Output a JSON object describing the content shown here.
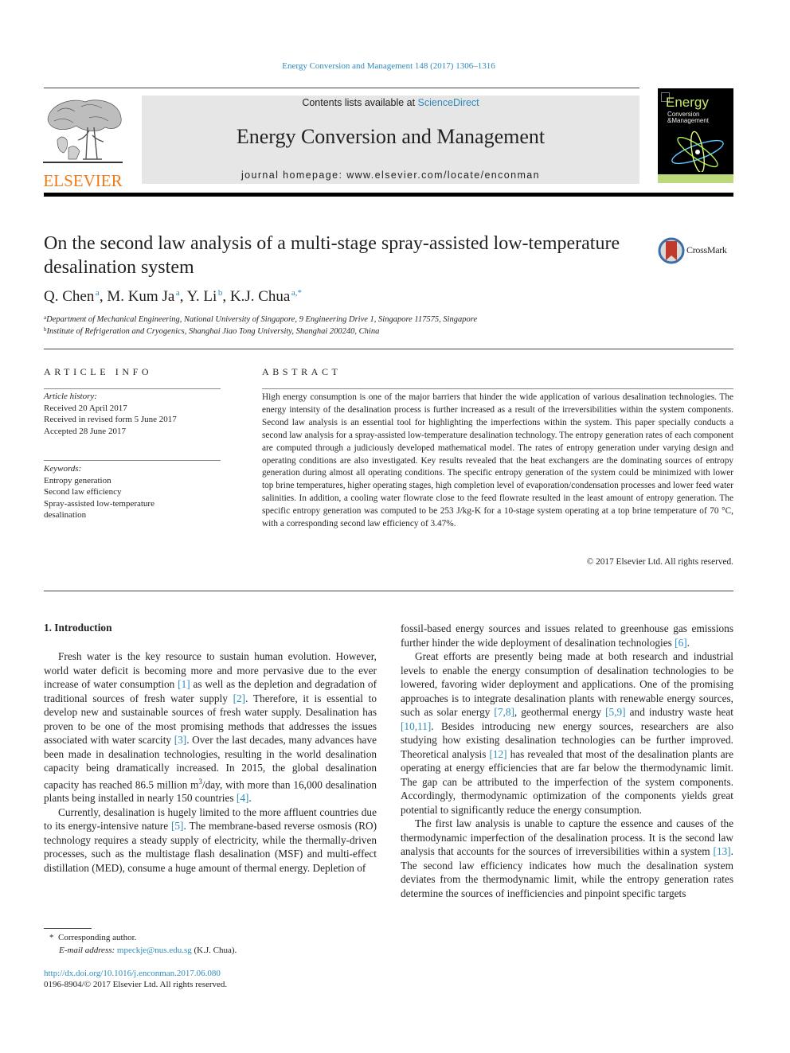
{
  "header": {
    "journal_reference": "Energy Conversion and Management 148 (2017) 1306–1316",
    "contents_prefix": "Contents lists available at ",
    "contents_link": "ScienceDirect",
    "journal_name": "Energy Conversion and Management",
    "homepage_line": "journal homepage: www.elsevier.com/locate/enconman",
    "publisher_logo_text": "ELSEVIER",
    "cover": {
      "title": "Energy",
      "subtitle_1": "Conversion",
      "subtitle_2": "&Management"
    },
    "colors": {
      "link": "#2c8bbb",
      "elsevier_orange": "#ee7b1a",
      "masthead_gray": "#e6e6e6"
    }
  },
  "article": {
    "title": "On the second law analysis of a multi-stage spray-assisted low-temperature desalination system",
    "crossmark_label": "CrossMark",
    "authors": [
      {
        "name": "Q. Chen",
        "sup": "a"
      },
      {
        "name": "M. Kum Ja",
        "sup": "a"
      },
      {
        "name": "Y. Li",
        "sup": "b"
      },
      {
        "name": "K.J. Chua",
        "sup": "a,*"
      }
    ],
    "affiliations": [
      {
        "label": "a",
        "text": "Department of Mechanical Engineering, National University of Singapore, 9 Engineering Drive 1, Singapore 117575, Singapore"
      },
      {
        "label": "b",
        "text": "Institute of Refrigeration and Cryogenics, Shanghai Jiao Tong University, Shanghai 200240, China"
      }
    ]
  },
  "article_info": {
    "heading": "ARTICLE INFO",
    "history_label": "Article history:",
    "history": [
      "Received 20 April 2017",
      "Received in revised form 5 June 2017",
      "Accepted 28 June 2017"
    ],
    "keywords_label": "Keywords:",
    "keywords": [
      "Entropy generation",
      "Second law efficiency",
      "Spray-assisted low-temperature",
      "desalination"
    ]
  },
  "abstract": {
    "heading": "ABSTRACT",
    "text": "High energy consumption is one of the major barriers that hinder the wide application of various desalination technologies. The energy intensity of the desalination process is further increased as a result of the irreversibilities within the system components. Second law analysis is an essential tool for highlighting the imperfections within the system. This paper specially conducts a second law analysis for a spray-assisted low-temperature desalination technology. The entropy generation rates of each component are computed through a judiciously developed mathematical model. The rates of entropy generation under varying design and operating conditions are also investigated. Key results revealed that the heat exchangers are the dominating sources of entropy generation during almost all operating conditions. The specific entropy generation of the system could be minimized with lower top brine temperatures, higher operating stages, high completion level of evaporation/condensation processes and lower feed water salinities. In addition, a cooling water flowrate close to the feed flowrate resulted in the least amount of entropy generation. The specific entropy generation was computed to be 253 J/kg-K for a 10-stage system operating at a top brine temperature of 70 °C, with a corresponding second law efficiency of 3.47%.",
    "copyright": "© 2017 Elsevier Ltd. All rights reserved."
  },
  "body": {
    "section_heading": "1. Introduction",
    "left_column": {
      "p1": [
        {
          "t": "Fresh water is the key resource to sustain human evolution. However, world water deficit is becoming more and more pervasive due to the ever increase of water consumption "
        },
        {
          "ref": "[1]"
        },
        {
          "t": " as well as the depletion and degradation of traditional sources of fresh water supply "
        },
        {
          "ref": "[2]"
        },
        {
          "t": ". Therefore, it is essential to develop new and sustainable sources of fresh water supply. Desalination has proven to be one of the most promising methods that addresses the issues associated with water scarcity "
        },
        {
          "ref": "[3]"
        },
        {
          "t": ". Over the last decades, many advances have been made in desalination technologies, resulting in the world desalination capacity being dramatically increased. In 2015, the global desalination capacity has reached 86.5 million m"
        },
        {
          "sup": "3"
        },
        {
          "t": "/day, with more than 16,000 desalination plants being installed in nearly 150 countries "
        },
        {
          "ref": "[4]"
        },
        {
          "t": "."
        }
      ],
      "p2": [
        {
          "t": "Currently, desalination is hugely limited to the more affluent countries due to its energy-intensive nature "
        },
        {
          "ref": "[5]"
        },
        {
          "t": ". The membrane-based reverse osmosis (RO) technology requires a steady supply of electricity, while the thermally-driven processes, such as the multistage flash desalination (MSF) and multi-effect distillation (MED), consume a huge amount of thermal energy. Depletion of"
        }
      ]
    },
    "right_column": {
      "p0": [
        {
          "t": "fossil-based energy sources and issues related to greenhouse gas emissions further hinder the wide deployment of desalination technologies "
        },
        {
          "ref": "[6]"
        },
        {
          "t": "."
        }
      ],
      "p1": [
        {
          "t": "Great efforts are presently being made at both research and industrial levels to enable the energy consumption of desalination technologies to be lowered, favoring wider deployment and applications. One of the promising approaches is to integrate desalination plants with renewable energy sources, such as solar energy "
        },
        {
          "ref": "[7,8]"
        },
        {
          "t": ", geothermal energy "
        },
        {
          "ref": "[5,9]"
        },
        {
          "t": " and industry waste heat "
        },
        {
          "ref": "[10,11]"
        },
        {
          "t": ". Besides introducing new energy sources, researchers are also studying how existing desalination technologies can be further improved. Theoretical analysis "
        },
        {
          "ref": "[12]"
        },
        {
          "t": " has revealed that most of the desalination plants are operating at energy efficiencies that are far below the thermodynamic limit. The gap can be attributed to the imperfection of the system components. Accordingly, thermodynamic optimization of the components yields great potential to significantly reduce the energy consumption."
        }
      ],
      "p2": [
        {
          "t": "The first law analysis is unable to capture the essence and causes of the thermodynamic imperfection of the desalination process. It is the second law analysis that accounts for the sources of irreversibilities within a system "
        },
        {
          "ref": "[13]"
        },
        {
          "t": ". The second law efficiency indicates how much the desalination system deviates from the thermodynamic limit, while the entropy generation rates determine the sources of inefficiencies and pinpoint specific targets"
        }
      ]
    }
  },
  "footnotes": {
    "corresponding_marker": "*",
    "corresponding_text": "Corresponding author.",
    "email_label": "E-mail address:",
    "email": "mpeckje@nus.edu.sg",
    "email_owner": " (K.J. Chua).",
    "doi": "http://dx.doi.org/10.1016/j.enconman.2017.06.080",
    "issn_copyright": "0196-8904/© 2017 Elsevier Ltd. All rights reserved."
  }
}
